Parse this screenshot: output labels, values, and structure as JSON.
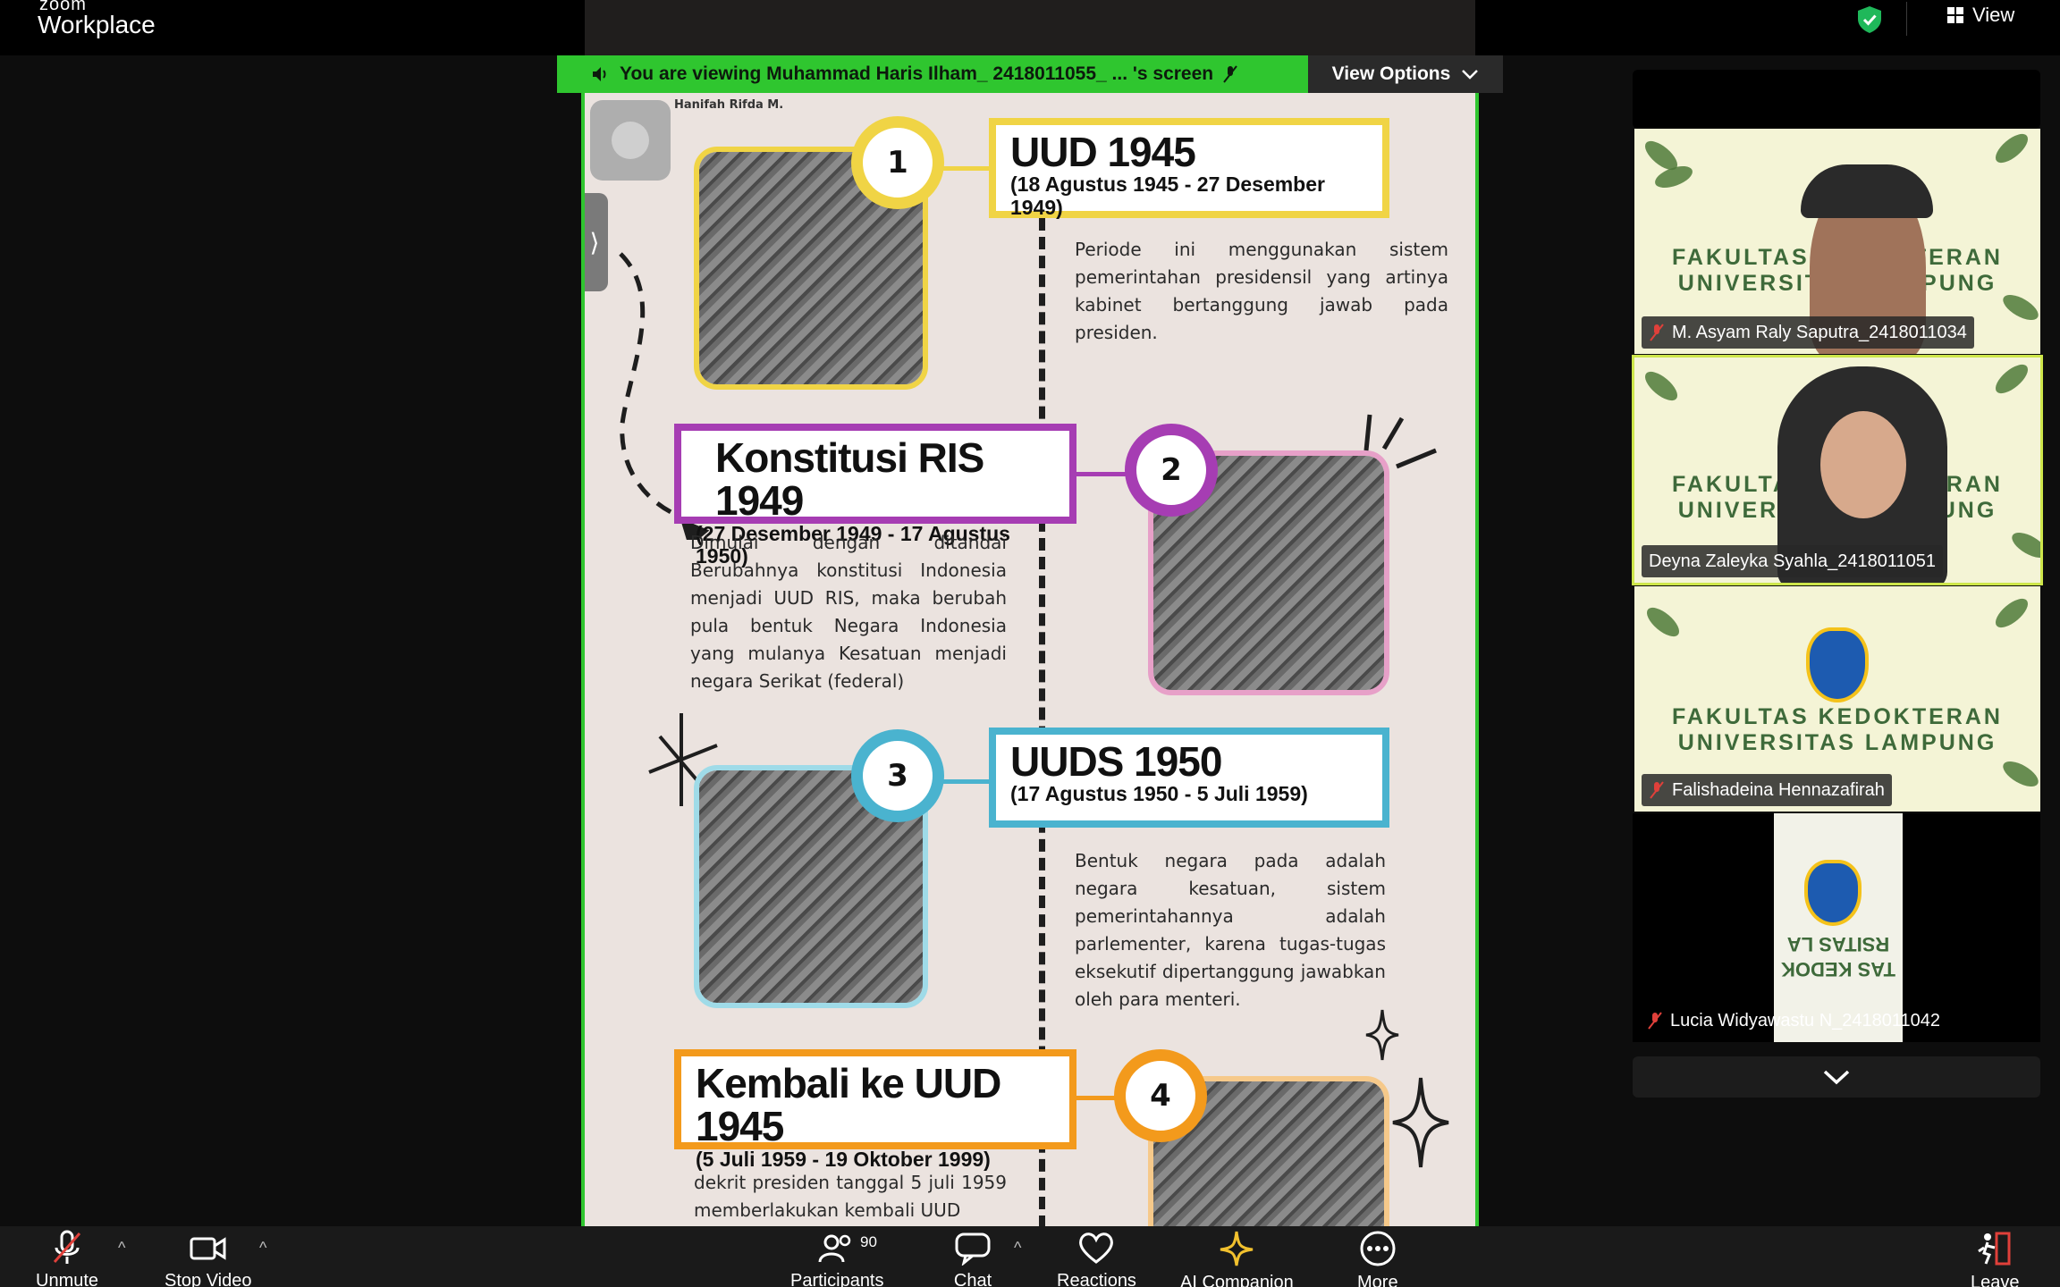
{
  "app": {
    "brand_small": "zoom",
    "brand": "Workplace"
  },
  "topbar": {
    "view_label": "View"
  },
  "share": {
    "banner_text": "You are viewing  Muhammad Haris Ilham_ 2418011055_ ... 's screen",
    "view_options_label": "View Options"
  },
  "slide": {
    "author": "Hanifah Rifda M.",
    "items": [
      {
        "number": "1",
        "title": "UUD 1945",
        "period": "(18 Agustus 1945 - 27 Desember 1949)",
        "desc": "Periode ini menggunakan sistem pemerintahan presidensil yang artinya kabinet bertanggung jawab pada presiden.",
        "color": "#f0d445"
      },
      {
        "number": "2",
        "title": "Konstitusi RIS 1949",
        "period": "(27 Desember 1949 - 17 Agustus 1950)",
        "desc": "Dimulai dengan ditandai Berubahnya konstitusi Indonesia menjadi UUD RIS, maka berubah pula bentuk Negara Indonesia yang mulanya Kesatuan menjadi negara Serikat (federal)",
        "color": "#a63db3"
      },
      {
        "number": "3",
        "title": "UUDS 1950",
        "period": "(17 Agustus 1950 - 5 Juli 1959)",
        "desc": "Bentuk negara pada adalah negara kesatuan, sistem pemerintahannya adalah parlementer, karena tugas-tugas eksekutif dipertanggung jawabkan oleh para menteri.",
        "color": "#4ab3cf"
      },
      {
        "number": "4",
        "title": "Kembali ke UUD 1945",
        "period": "(5 Juli 1959 - 19 Oktober 1999)",
        "desc": "dekrit presiden tanggal 5 juli 1959 memberlakukan kembali UUD",
        "color": "#f39a1c"
      }
    ]
  },
  "gallery": {
    "tiles": [
      {
        "name": "M. Asyam Raly Saputra_2418011034",
        "bg_line1": "FAKULTAS KEDOKTERAN",
        "bg_line2": "UNIVERSITAS LAMPUNG"
      },
      {
        "name": "Deyna Zaleyka Syahla_2418011051",
        "bg_line1": "FAKULTAS KEDOKTERAN",
        "bg_line2": "UNIVERSITAS LAMPUNG"
      },
      {
        "name": "Falishadeina Hennazafirah",
        "bg_line1": "FAKULTAS KEDOKTERAN",
        "bg_line2": "UNIVERSITAS LAMPUNG"
      },
      {
        "name": "Lucia Widyawastu N_2418011042",
        "bg_line1": "TAS KEDOK",
        "bg_line2": "RSITAS LA"
      }
    ]
  },
  "toolbar": {
    "unmute": "Unmute",
    "stop_video": "Stop Video",
    "participants": "Participants",
    "participants_count": "90",
    "chat": "Chat",
    "reactions": "Reactions",
    "ai_companion": "AI Companion",
    "more": "More",
    "leave": "Leave"
  },
  "colors": {
    "share_green": "#2fc62f",
    "leave_red": "#e0403a",
    "ai_yellow": "#f2c12e"
  }
}
